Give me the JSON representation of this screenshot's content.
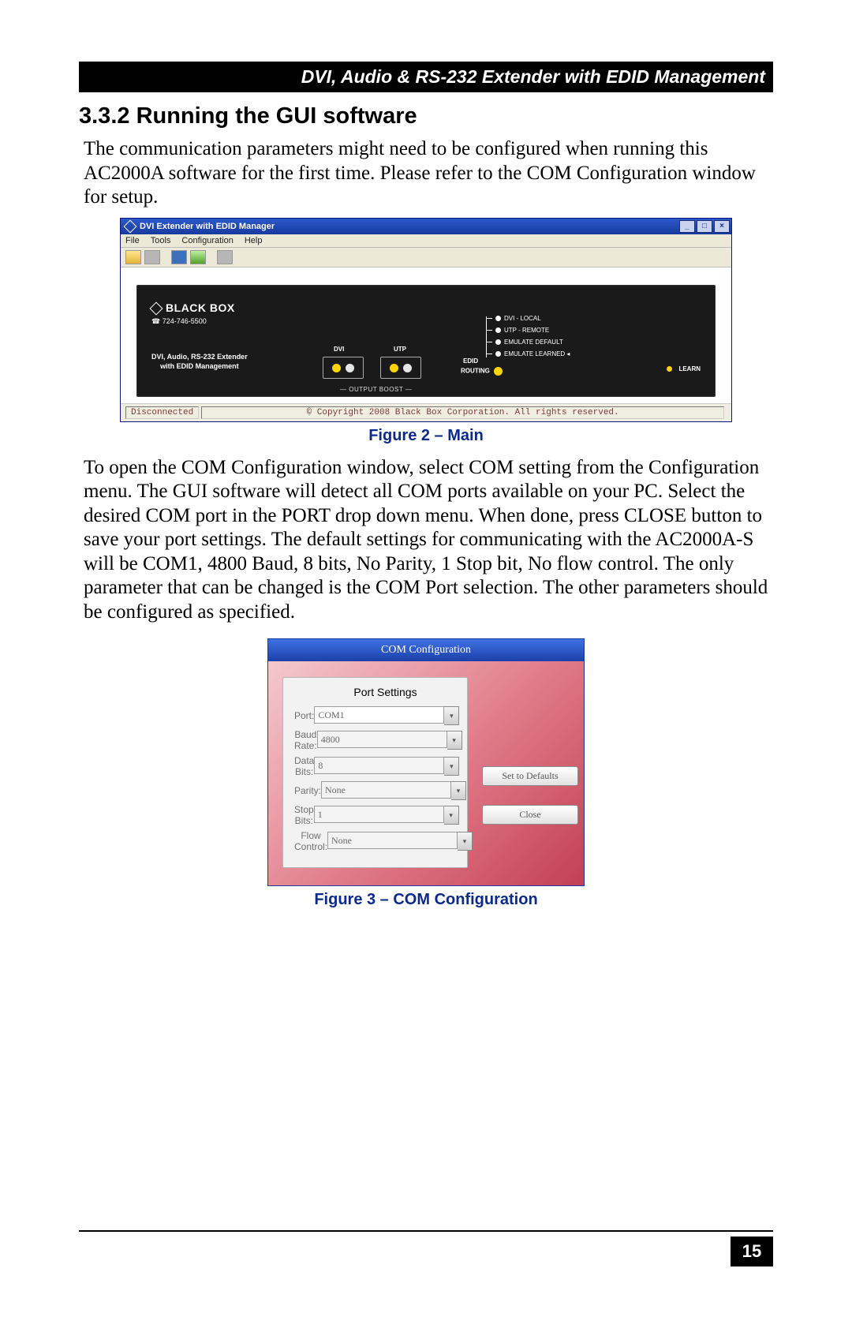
{
  "header": "DVI, Audio & RS-232 Extender with EDID Management",
  "section_no": "3.3.2",
  "section_title": "Running the GUI software",
  "para1": "The communication parameters might need to be configured when running this AC2000A software for the first time.  Please refer to the COM Configuration window for setup.",
  "fig2_caption": "Figure 2 – Main",
  "para2": "To open the COM Configuration window, select COM setting from the Configuration menu.  The GUI software will detect all COM ports available on your PC.  Select the desired COM port in the PORT drop down menu.  When done, press CLOSE button to save your port settings.  The default settings for communicating with the AC2000A-S will be COM1, 4800 Baud, 8 bits, No Parity, 1 Stop bit, No flow control.  The only parameter that can be changed is the COM Port selection.  The other parameters should be configured as specified.",
  "fig3_caption": "Figure 3 – COM Configuration",
  "page_number": "15",
  "app": {
    "title": "DVI Extender with EDID Manager",
    "menu": [
      "File",
      "Tools",
      "Configuration",
      "Help"
    ],
    "brand": "BLACK BOX",
    "phone": "724-746-5500",
    "subtitle1": "DVI, Audio, RS-232 Extender",
    "subtitle2": "with EDID Management",
    "port_dvi": "DVI",
    "port_utp": "UTP",
    "output_boost": "OUTPUT BOOST",
    "edid": "EDID",
    "routing": "ROUTING",
    "tree": {
      "a": "DVI - LOCAL",
      "b": "UTP - REMOTE",
      "c": "EMULATE DEFAULT",
      "d": "EMULATE LEARNED"
    },
    "learn": "LEARN",
    "status_left": "Disconnected",
    "status_right": "© Copyright 2008  Black Box Corporation. All rights reserved."
  },
  "dlg": {
    "title": "COM Configuration",
    "group": "Port Settings",
    "fields": {
      "port": {
        "label": "Port:",
        "value": "COM1",
        "enabled": true
      },
      "baud": {
        "label": "Baud Rate:",
        "value": "4800",
        "enabled": false
      },
      "data_bits": {
        "label": "Data Bits:",
        "value": "8",
        "enabled": false
      },
      "parity": {
        "label": "Parity:",
        "value": "None",
        "enabled": false
      },
      "stop_bits": {
        "label": "Stop Bits:",
        "value": "1",
        "enabled": false
      },
      "flow": {
        "label": "Flow Control:",
        "value": "None",
        "enabled": false
      }
    },
    "btn_defaults": "Set to Defaults",
    "btn_close": "Close"
  }
}
